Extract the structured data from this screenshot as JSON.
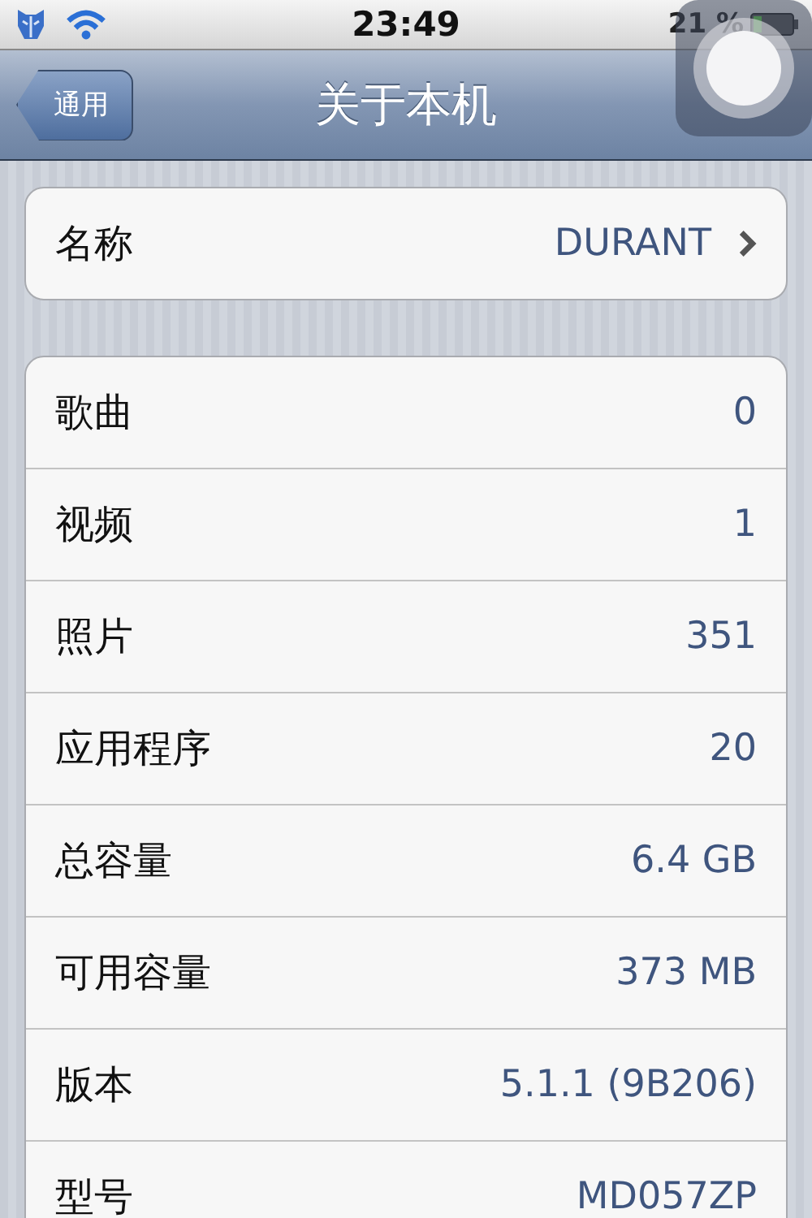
{
  "status_bar": {
    "time": "23:49",
    "battery": "21 %"
  },
  "nav_bar": {
    "title": "关于本机",
    "back": "通用"
  },
  "groups": [
    {
      "rows": [
        {
          "kind": "link",
          "label": "名称",
          "value": "DURANT"
        }
      ]
    },
    {
      "rows": [
        {
          "kind": "info",
          "label": "歌曲",
          "value": "0"
        },
        {
          "kind": "info",
          "label": "视频",
          "value": "1"
        },
        {
          "kind": "info",
          "label": "照片",
          "value": "351"
        },
        {
          "kind": "info",
          "label": "应用程序",
          "value": "20"
        },
        {
          "kind": "info",
          "label": "总容量",
          "value": "6.4 GB"
        },
        {
          "kind": "info",
          "label": "可用容量",
          "value": "373 MB"
        },
        {
          "kind": "info",
          "label": "版本",
          "value": "5.1.1 (9B206)"
        },
        {
          "kind": "info",
          "label": "型号",
          "value": "MD057ZP"
        }
      ]
    }
  ]
}
